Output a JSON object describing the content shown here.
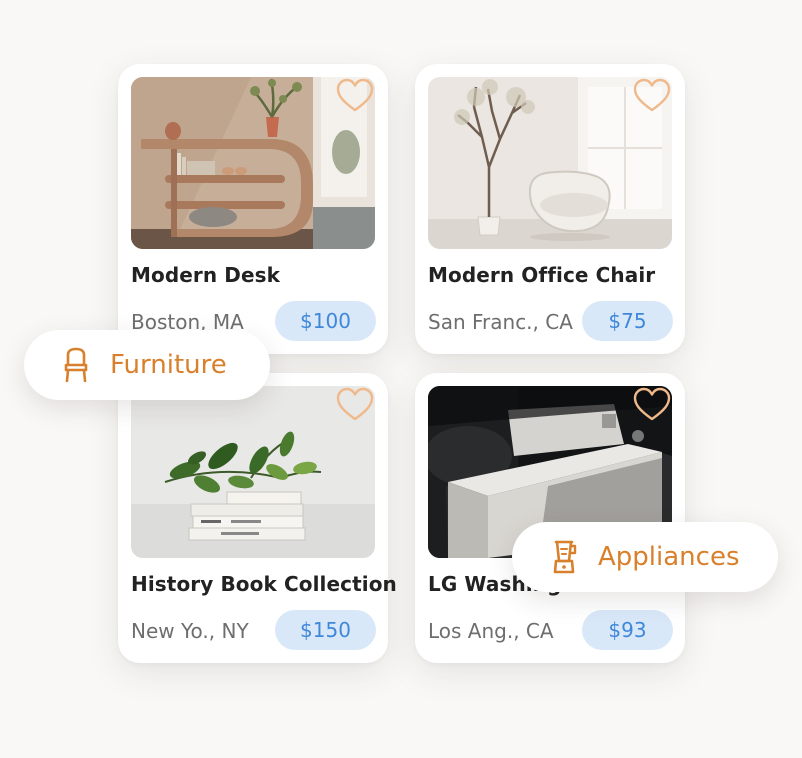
{
  "colors": {
    "accent": "#d9802c",
    "price_text": "#3f87d9",
    "price_bg": "#d9e8f9",
    "heart": "#efb98b"
  },
  "listings": [
    {
      "title": "Modern Desk",
      "location": "Boston, MA",
      "price": "$100",
      "image": "curved-wooden-shelf",
      "icon": "heart-icon"
    },
    {
      "title": "Modern Office Chair",
      "location": "San Franc., CA",
      "price": "$75",
      "image": "white-chair-with-tree",
      "icon": "heart-icon"
    },
    {
      "title": "History Book Collection",
      "location": "New Yo., NY",
      "price": "$150",
      "image": "book-stack-with-plant",
      "icon": "heart-icon"
    },
    {
      "title": "LG Washing",
      "location": "Los Ang., CA",
      "price": "$93",
      "image": "washing-machine",
      "icon": "heart-icon"
    }
  ],
  "chips": [
    {
      "label": "Furniture",
      "icon": "chair-icon"
    },
    {
      "label": "Appliances",
      "icon": "blender-icon"
    }
  ]
}
